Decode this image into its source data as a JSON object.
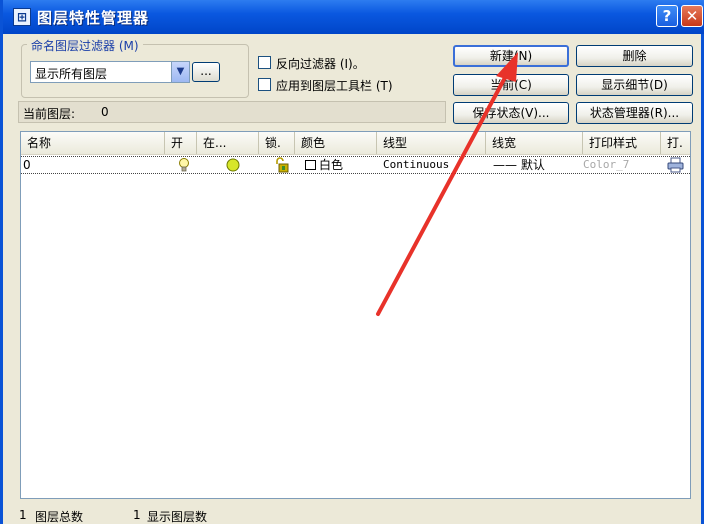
{
  "window": {
    "title": "图层特性管理器",
    "app_icon": "layer-app-icon",
    "help_label": "?",
    "close_label": "✕"
  },
  "filter": {
    "group_label": "命名图层过滤器 (M)",
    "selected": "显示所有图层",
    "more_label": "..."
  },
  "options": {
    "invert_label": "反向过滤器 (I)。",
    "invert_checked": false,
    "apply_toolbar_label": "应用到图层工具栏 (T)",
    "apply_toolbar_checked": false
  },
  "buttons": {
    "new": "新建(N)",
    "delete": "删除",
    "current": "当前(C)",
    "show_details": "显示细节(D)",
    "save_state": "保存状态(V)...",
    "state_manager": "状态管理器(R)..."
  },
  "current_layer": {
    "label": "当前图层:",
    "value": "0"
  },
  "table": {
    "columns": [
      "名称",
      "开",
      "在...",
      "锁.",
      "颜色",
      "线型",
      "线宽",
      "打印样式",
      "打."
    ],
    "rows": [
      {
        "name": "0",
        "on_icon": "lightbulb-icon",
        "freeze_icon": "sun-icon",
        "lock_icon": "unlock-icon",
        "color": "白色",
        "color_hex": "#ffffff",
        "linetype": "Continuous",
        "lineweight": "—— 默认",
        "plot_style": "Color_7",
        "plot_icon": "printer-icon"
      }
    ]
  },
  "status": {
    "total_count": "1",
    "total_label": "图层总数",
    "shown_count": "1",
    "shown_label": "显示图层数"
  },
  "annotation": {
    "arrow_color": "#e8322a"
  }
}
